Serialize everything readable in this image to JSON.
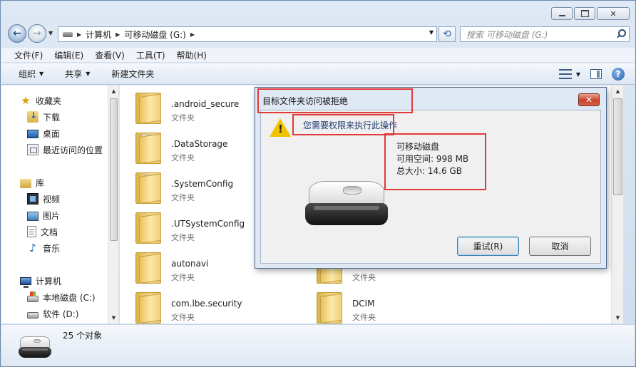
{
  "window": {
    "caption_buttons": [
      "minimize",
      "maximize",
      "close"
    ]
  },
  "address_bar": {
    "crumbs": [
      "计算机",
      "可移动磁盘 (G:)"
    ]
  },
  "search": {
    "placeholder": "搜索 可移动磁盘 (G:)"
  },
  "menubar": {
    "items": [
      "文件(F)",
      "编辑(E)",
      "查看(V)",
      "工具(T)",
      "帮助(H)"
    ]
  },
  "toolbar": {
    "organize": "组织",
    "share": "共享",
    "new_folder": "新建文件夹"
  },
  "navpane": {
    "favorites": {
      "label": "收藏夹",
      "items": [
        "下载",
        "桌面",
        "最近访问的位置"
      ]
    },
    "libraries": {
      "label": "库",
      "items": [
        "视频",
        "图片",
        "文档",
        "音乐"
      ]
    },
    "computer": {
      "label": "计算机",
      "items": [
        "本地磁盘 (C:)",
        "软件 (D:)"
      ]
    }
  },
  "files": [
    {
      "name": ".android_secure",
      "type": "文件夹",
      "icon": "folder"
    },
    {
      "name": ".DataStorage",
      "type": "文件夹",
      "icon": "folder-docs"
    },
    {
      "name": ".SystemConfig",
      "type": "文件夹",
      "icon": "folder-sheets"
    },
    {
      "name": ".UTSystemConfig",
      "type": "文件夹",
      "icon": "folder-files"
    },
    {
      "name": "autonavi",
      "type": "文件夹",
      "icon": "folder-files"
    },
    {
      "name": "com.lbe.security",
      "type": "文件夹",
      "icon": "folder-files"
    },
    {
      "name": "",
      "type": "文件夹",
      "icon": "folder-files"
    },
    {
      "name": "DCIM",
      "type": "文件夹",
      "icon": "folder-files"
    }
  ],
  "details": {
    "count": "25 个对象"
  },
  "dialog": {
    "title": "目标文件夹访问被拒绝",
    "message": "您需要权限来执行此操作",
    "drive_name": "可移动磁盘",
    "free_space": "可用空间: 998 MB",
    "total_size": "总大小: 14.6 GB",
    "retry": "重试(R)",
    "cancel": "取消"
  },
  "colors": {
    "highlight": "#e03a3a",
    "accent": "#1e3d74"
  }
}
